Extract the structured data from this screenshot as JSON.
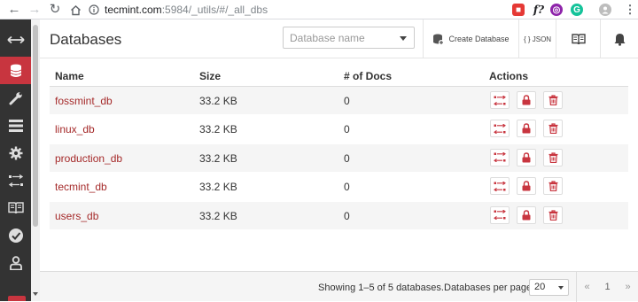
{
  "browser": {
    "url_host": "tecmint.com",
    "url_path": ":5984/_utils/#/_all_dbs",
    "ext_fusion_label": "f?"
  },
  "header": {
    "title": "Databases",
    "db_select_placeholder": "Database name",
    "create_label": "Create Database",
    "json_label": "{ } JSON"
  },
  "table": {
    "columns": [
      "Name",
      "Size",
      "# of Docs",
      "Actions"
    ],
    "rows": [
      {
        "name": "fossmint_db",
        "size": "33.2 KB",
        "docs": "0"
      },
      {
        "name": "linux_db",
        "size": "33.2 KB",
        "docs": "0"
      },
      {
        "name": "production_db",
        "size": "33.2 KB",
        "docs": "0"
      },
      {
        "name": "tecmint_db",
        "size": "33.2 KB",
        "docs": "0"
      },
      {
        "name": "users_db",
        "size": "33.2 KB",
        "docs": "0"
      }
    ]
  },
  "footer": {
    "showing": "Showing 1–5 of 5 databases.",
    "per_page_label": "Databases per page",
    "per_page_value": "20",
    "prev": "«",
    "page": "1",
    "next": "»"
  },
  "colors": {
    "sidebar_bg": "#333333",
    "accent_red": "#c8353f",
    "link_red": "#a52a2a"
  },
  "icons": {
    "sidebar": [
      "collapse-arrows-icon",
      "database-icon",
      "wrench-icon",
      "server-icon",
      "gear-icon",
      "replication-icon",
      "docs-book-icon",
      "verify-check-icon",
      "user-icon"
    ],
    "row_actions": [
      "replicate-icon",
      "lock-icon",
      "trash-icon"
    ]
  }
}
